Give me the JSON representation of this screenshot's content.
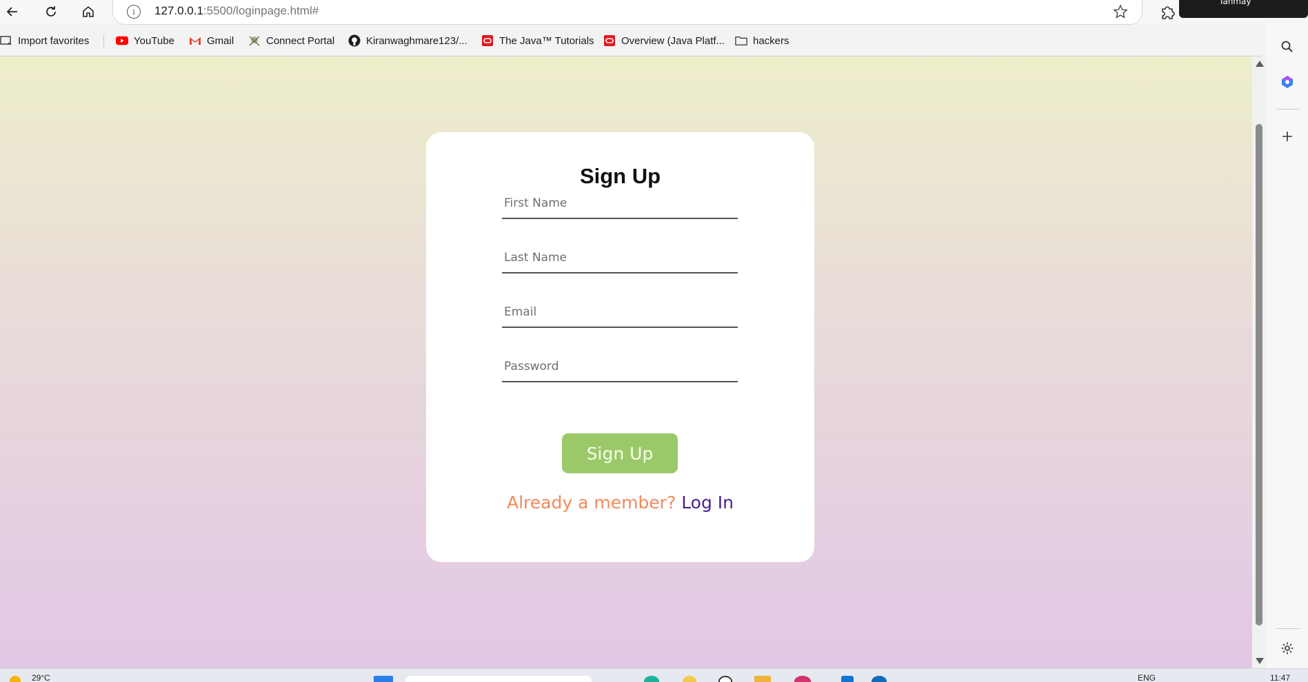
{
  "browser": {
    "url_host": "127.0.0.1",
    "url_rest": ":5500/loginpage.html#",
    "toast_text": "Tanmay"
  },
  "favorites": [
    {
      "label": "Import favorites",
      "icon": "import-icon"
    },
    {
      "label": "YouTube",
      "icon": "youtube-icon",
      "color": "#ff0000"
    },
    {
      "label": "Gmail",
      "icon": "gmail-icon",
      "color": "#ea4335"
    },
    {
      "label": "Connect Portal",
      "icon": "portal-icon"
    },
    {
      "label": "Kiranwaghmare123/...",
      "icon": "github-icon"
    },
    {
      "label": "The Java™ Tutorials",
      "icon": "oracle-icon",
      "color": "#e0191f"
    },
    {
      "label": "Overview (Java Platf...",
      "icon": "oracle-icon",
      "color": "#e0191f"
    },
    {
      "label": "hackers",
      "icon": "folder-icon"
    }
  ],
  "form": {
    "title": "Sign Up",
    "first_name_placeholder": "First Name",
    "last_name_placeholder": "Last Name",
    "email_placeholder": "Email",
    "password_placeholder": "Password",
    "submit_label": "Sign Up",
    "member_question": "Already a member?",
    "login_link": "Log In"
  },
  "taskbar": {
    "weather": "29°C",
    "language": "ENG",
    "time": "11:47"
  },
  "colors": {
    "button_bg": "#9bc96a",
    "member_question": "#f08a5d",
    "login_link": "#4a1f8f",
    "gradient_top": "#eeeecb",
    "gradient_bottom": "#e3c7e6"
  }
}
